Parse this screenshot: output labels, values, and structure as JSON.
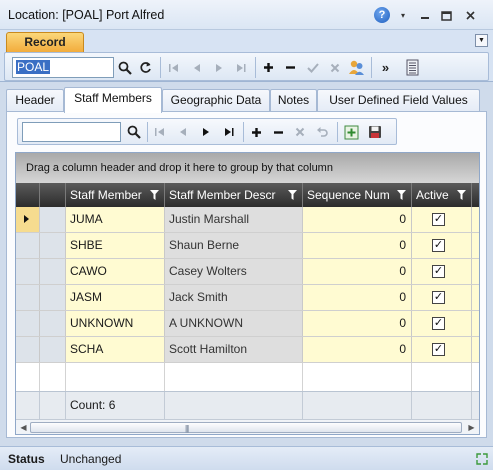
{
  "window": {
    "title": "Location: [POAL] Port Alfred",
    "help_icon": "?",
    "dropdown_icon": "▾",
    "minimize_icon": "–",
    "restore_icon": "▢",
    "close_icon": "✕"
  },
  "ribbon": {
    "tab_label": "Record",
    "search_value": "POAL"
  },
  "tabs": [
    {
      "label": "Header"
    },
    {
      "label": "Staff Members"
    },
    {
      "label": "Geographic Data"
    },
    {
      "label": "Notes"
    },
    {
      "label": "User Defined Field Values"
    }
  ],
  "grid": {
    "group_hint": "Drag a column header and drop it here to group by that column",
    "columns": [
      "Staff Member",
      "Staff Member Descr",
      "Sequence Num",
      "Active"
    ],
    "rows": [
      {
        "code": "JUMA",
        "description": "Justin Marshall",
        "sequence": "0",
        "active": true
      },
      {
        "code": "SHBE",
        "description": "Shaun Berne",
        "sequence": "0",
        "active": true
      },
      {
        "code": "CAWO",
        "description": "Casey Wolters",
        "sequence": "0",
        "active": true
      },
      {
        "code": "JASM",
        "description": "Jack Smith",
        "sequence": "0",
        "active": true
      },
      {
        "code": "UNKNOWN",
        "description": "A UNKNOWN",
        "sequence": "0",
        "active": true
      },
      {
        "code": "SCHA",
        "description": "Scott Hamilton",
        "sequence": "0",
        "active": true
      }
    ],
    "footer_count": "Count: 6"
  },
  "status": {
    "label": "Status",
    "value": "Unchanged"
  }
}
